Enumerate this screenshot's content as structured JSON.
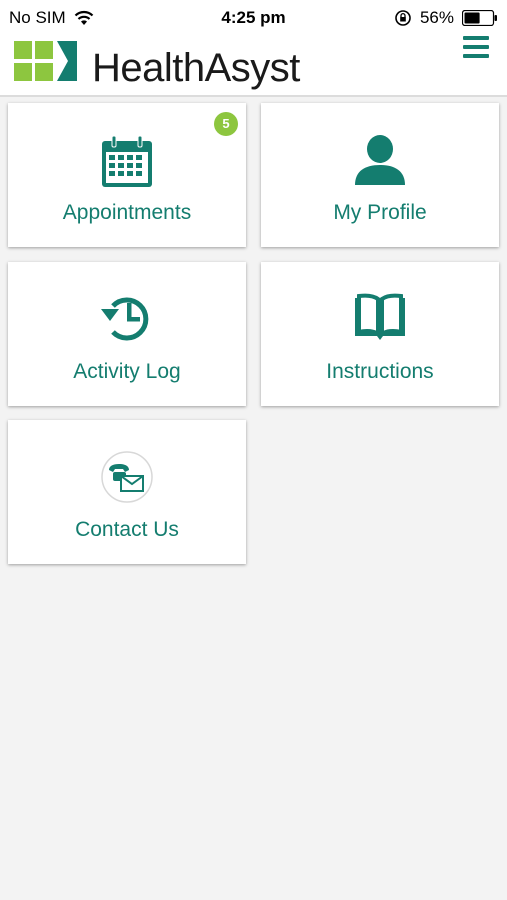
{
  "status_bar": {
    "carrier": "No SIM",
    "time": "4:25 pm",
    "battery_percent": "56%",
    "battery_level": 0.56
  },
  "header": {
    "brand": "HealthAsyst",
    "logo_icon": "healthasyst-logo",
    "menu_icon": "hamburger-menu-icon"
  },
  "colors": {
    "accent": "#147d6f",
    "badge": "#8dc63f",
    "logo_green": "#8dc63f",
    "background": "#f3f3f3"
  },
  "tiles": [
    {
      "label": "Appointments",
      "icon": "calendar-icon",
      "badge": "5"
    },
    {
      "label": "My Profile",
      "icon": "user-icon"
    },
    {
      "label": "Activity Log",
      "icon": "history-icon"
    },
    {
      "label": "Instructions",
      "icon": "book-icon"
    },
    {
      "label": "Contact Us",
      "icon": "phone-mail-icon"
    }
  ]
}
